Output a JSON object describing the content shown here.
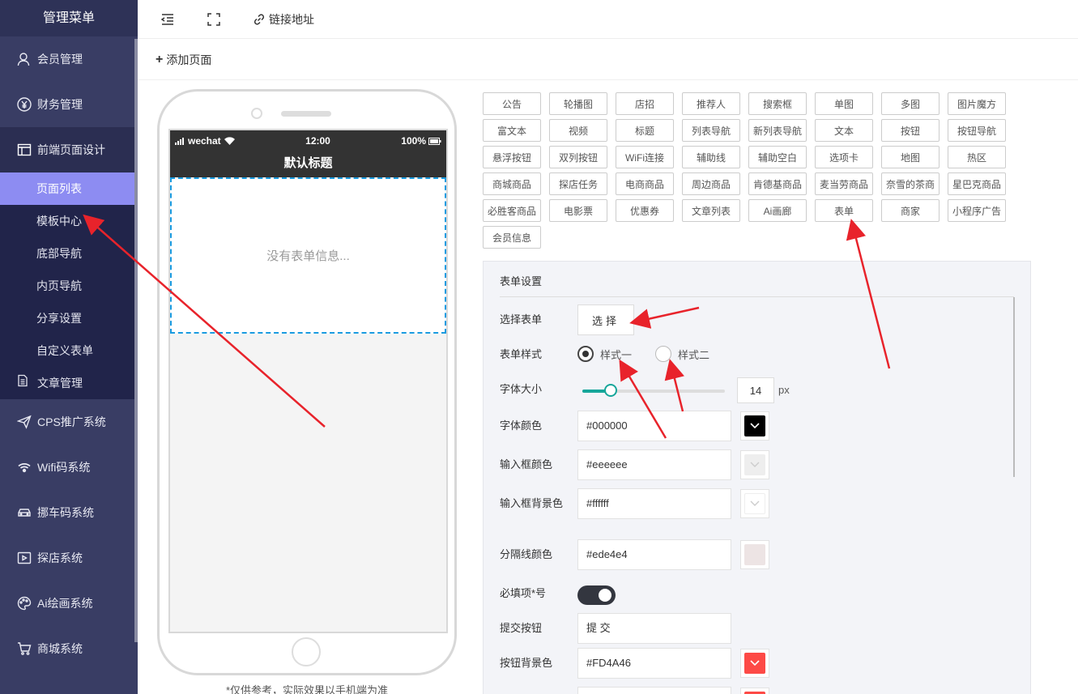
{
  "sidebar": {
    "title": "管理菜单",
    "items": [
      {
        "label": "会员管理",
        "icon": "user-icon"
      },
      {
        "label": "财务管理",
        "icon": "yen-icon"
      },
      {
        "label": "前端页面设计",
        "icon": "layout-icon"
      }
    ],
    "subitems": [
      "页面列表",
      "模板中心",
      "底部导航",
      "内页导航",
      "分享设置",
      "自定义表单"
    ],
    "article": {
      "label": "文章管理",
      "icon": "document-icon"
    },
    "systems": [
      {
        "label": "CPS推广系统",
        "icon": "send-icon"
      },
      {
        "label": "Wifi码系统",
        "icon": "wifi-icon"
      },
      {
        "label": "挪车码系统",
        "icon": "car-icon"
      },
      {
        "label": "探店系统",
        "icon": "video-icon"
      },
      {
        "label": "Ai绘画系统",
        "icon": "palette-icon"
      },
      {
        "label": "商城系统",
        "icon": "cart-icon"
      }
    ]
  },
  "topbar": {
    "link_label": "链接地址"
  },
  "subbar": {
    "add_label": "添加页面"
  },
  "phone": {
    "carrier": "wechat",
    "time": "12:00",
    "battery": "100%",
    "nav_title": "默认标题",
    "placeholder": "没有表单信息...",
    "note": "*仅供参考，实际效果以手机端为准"
  },
  "components": [
    "公告",
    "轮播图",
    "店招",
    "推荐人",
    "搜索框",
    "单图",
    "多图",
    "图片魔方",
    "富文本",
    "视频",
    "标题",
    "列表导航",
    "新列表导航",
    "文本",
    "按钮",
    "按钮导航",
    "悬浮按钮",
    "双列按钮",
    "WiFi连接",
    "辅助线",
    "辅助空白",
    "选项卡",
    "地图",
    "热区",
    "商城商品",
    "探店任务",
    "电商商品",
    "周边商品",
    "肯德基商品",
    "麦当劳商品",
    "奈雪的茶商",
    "星巴克商品",
    "必胜客商品",
    "电影票",
    "优惠券",
    "文章列表",
    "Ai画廊",
    "表单",
    "商家",
    "小程序广告",
    "会员信息"
  ],
  "form_settings": {
    "title": "表单设置",
    "select_label": "选择表单",
    "select_button": "选择",
    "style_label": "表单样式",
    "style_options": [
      "样式一",
      "样式二"
    ],
    "style_selected": "样式一",
    "font_size_label": "字体大小",
    "font_size": "14",
    "font_size_unit": "px",
    "font_size_fraction": 0.2,
    "font_color_label": "字体颜色",
    "font_color": "#000000",
    "input_border_label": "输入框颜色",
    "input_border_color": "#eeeeee",
    "input_bg_label": "输入框背景色",
    "input_bg_color": "#ffffff",
    "divider_label": "分隔线颜色",
    "divider_color": "#ede4e4",
    "required_label": "必填项*号",
    "required_on": true,
    "submit_label": "提交按钮",
    "submit_text": "提 交",
    "button_bg_label": "按钮背景色",
    "button_bg_color": "#FD4A46"
  }
}
